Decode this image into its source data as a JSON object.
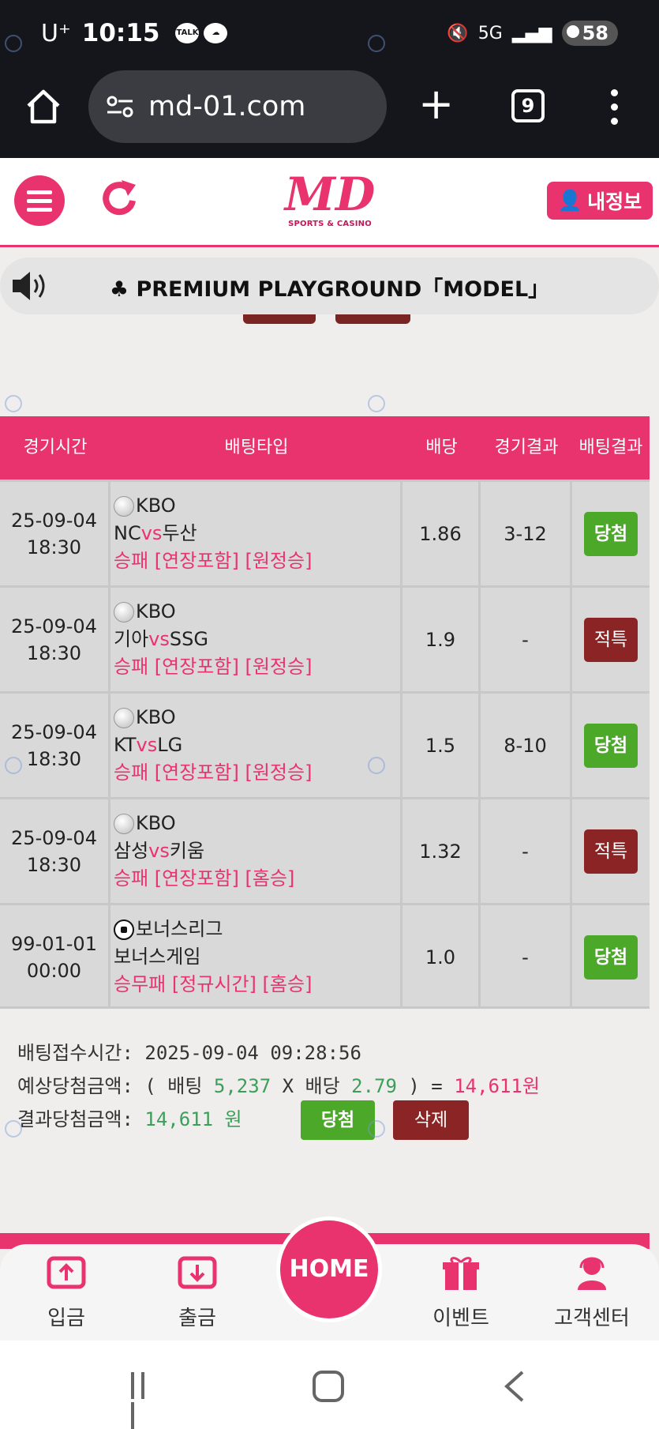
{
  "status_bar": {
    "carrier": "U⁺",
    "time": "10:15",
    "notif_talk": "TALK",
    "network": "5G",
    "battery": "58"
  },
  "browser": {
    "url": "md-01.com",
    "tab_count": "9"
  },
  "header": {
    "logo_text": "MD",
    "logo_sub": "SPORTS & CASINO",
    "my_info_label": "내정보"
  },
  "notice": {
    "text": "♣ PREMIUM PLAYGROUND「MODEL」"
  },
  "table": {
    "headers": [
      "경기시간",
      "배팅타입",
      "배당",
      "경기결과",
      "배팅결과"
    ],
    "rows": [
      {
        "date": "25-09-04",
        "time": "18:30",
        "league": "KBO",
        "home": "NC",
        "vs": "vs",
        "away": "두산",
        "market": "승패 [연장포함] [원정승]",
        "odds": "1.86",
        "score": "3-12",
        "result": "당첨"
      },
      {
        "date": "25-09-04",
        "time": "18:30",
        "league": "KBO",
        "home": "기아",
        "vs": "vs",
        "away": "SSG",
        "market": "승패 [연장포함] [원정승]",
        "odds": "1.9",
        "score": "-",
        "result": "적특"
      },
      {
        "date": "25-09-04",
        "time": "18:30",
        "league": "KBO",
        "home": "KT",
        "vs": "vs",
        "away": "LG",
        "market": "승패 [연장포함] [원정승]",
        "odds": "1.5",
        "score": "8-10",
        "result": "당첨"
      },
      {
        "date": "25-09-04",
        "time": "18:30",
        "league": "KBO",
        "home": "삼성",
        "vs": "vs",
        "away": "키움",
        "market": "승패 [연장포함] [홈승]",
        "odds": "1.32",
        "score": "-",
        "result": "적특"
      },
      {
        "date": "99-01-01",
        "time": "00:00",
        "league": "보너스리그",
        "home": "보너스게임",
        "vs": "",
        "away": "",
        "market": "승무패 [정규시간] [홈승]",
        "odds": "1.0",
        "score": "-",
        "result": "당첨"
      }
    ]
  },
  "summary": {
    "accept_label": "배팅접수시간:",
    "accept_time": "2025-09-04 09:28:56",
    "expected_label": "예상당첨금액:",
    "expected_open": "( 배팅",
    "bet_amount": "5,237",
    "times": "X 배당",
    "total_odds": "2.79",
    "expected_close": ") =",
    "expected_win": "14,611원",
    "result_label": "결과당첨금액:",
    "result_win": "14,611 원",
    "win_button": "당첨",
    "delete_button": "삭제"
  },
  "bottom_nav": {
    "deposit": "입금",
    "withdraw": "출금",
    "home": "HOME",
    "event": "이벤트",
    "support": "고객센터"
  },
  "colors": {
    "brand_pink": "#e8336f",
    "win_green": "#4ca829",
    "refund_red": "#8b2424",
    "dark_bar": "#15161b"
  }
}
